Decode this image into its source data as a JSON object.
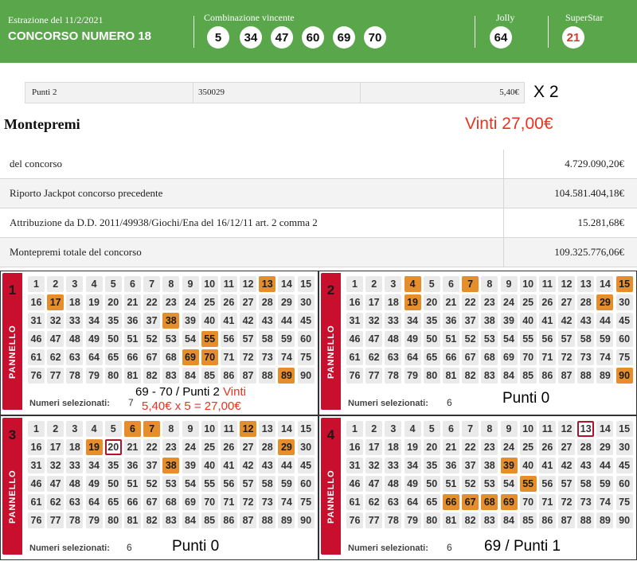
{
  "header": {
    "date": "Estrazione del 11/2/2021",
    "title": "CONCORSO NUMERO 18",
    "winning_label": "Combinazione vincente",
    "winning_numbers": [
      "5",
      "34",
      "47",
      "60",
      "69",
      "70"
    ],
    "jolly_label": "Jolly",
    "jolly": "64",
    "superstar_label": "SuperStar",
    "superstar": "21",
    "colors": {
      "bar": "#5aa64b",
      "superstar_number": "#d63a2c"
    }
  },
  "prize_row": {
    "category": "Punti 2",
    "winners": "350029",
    "amount": "5,40€"
  },
  "annotations": {
    "multiplier": "X 2",
    "total_won": "Vinti 27,00€",
    "panel1_line1": "69 - 70 / Punti 2",
    "panel1_vinti": "Vinti",
    "panel1_line2": "5,40€ x 5 = 27,00€",
    "panel2": "Punti 0",
    "panel3": "Punti 0",
    "panel4": "69 / Punti 1"
  },
  "montepremi": {
    "title": "Montepremi",
    "rows": [
      {
        "label": "del concorso",
        "value": "4.729.090,20€"
      },
      {
        "label": "Riporto Jackpot concorso precedente",
        "value": "104.581.404,18€"
      },
      {
        "label": "Attribuzione da D.D. 2011/49938/Giochi/Ena del 16/12/11 art. 2 comma 2",
        "value": "15.281,68€"
      },
      {
        "label": "Montepremi totale del concorso",
        "value": "109.325.776,06€"
      }
    ]
  },
  "panels": [
    {
      "number": "1",
      "label": "PANNELLO",
      "selected_label": "Numeri selezionati:",
      "selected_count": "7",
      "selected": [
        13,
        17,
        38,
        55,
        69,
        70,
        89
      ],
      "circled": []
    },
    {
      "number": "2",
      "label": "PANNELLO",
      "selected_label": "Numeri selezionati:",
      "selected_count": "6",
      "selected": [
        4,
        7,
        15,
        19,
        29,
        90
      ],
      "circled": []
    },
    {
      "number": "3",
      "label": "PANNELLO",
      "selected_label": "Numeri selezionati:",
      "selected_count": "6",
      "selected": [
        6,
        7,
        12,
        19,
        29,
        38
      ],
      "circled": [
        20
      ]
    },
    {
      "number": "4",
      "label": "PANNELLO",
      "selected_label": "Numeri selezionati:",
      "selected_count": "6",
      "selected": [
        39,
        55,
        66,
        67,
        68,
        69
      ],
      "circled": [
        13
      ]
    }
  ],
  "colors": {
    "selected_cell": "#e58e2b",
    "panel_tab": "#c8102e",
    "annotation_red": "#e8331f"
  }
}
